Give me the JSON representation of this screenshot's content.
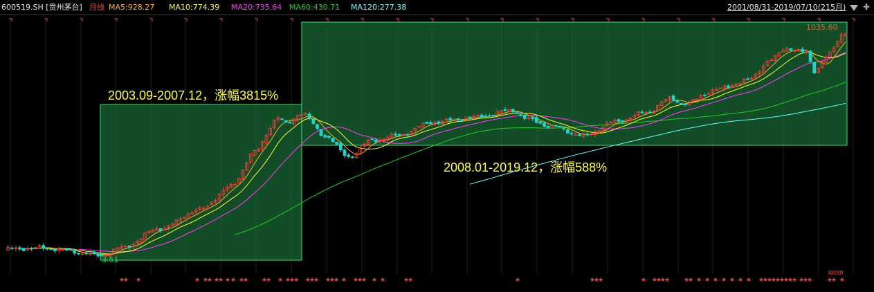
{
  "header": {
    "symbol": "600519.SH [贵州茅台]",
    "period": "月线",
    "ma5": "MA5:928.27",
    "ma10": "MA10:774.39",
    "ma20": "MA20:735.64",
    "ma60": "MA60:430.71",
    "ma120": "MA120:277.38",
    "date_range": "2001/08/31-2019/07/10(215月)",
    "dropdown_icon": "triangle-down-icon",
    "expand_icon": "plus-icon"
  },
  "colors": {
    "background": "#000000",
    "up": "#ff3b3b",
    "down": "#22d3c9",
    "ma5": "#ffb21e",
    "ma10": "#ffff33",
    "ma20": "#ff3bff",
    "ma60": "#22cc22",
    "ma120": "#66ffff",
    "highlight_fill": "#1a6b38",
    "highlight_border": "#40e080",
    "annotation": "#ffff44",
    "star": "#ff3b3b"
  },
  "chart_data": {
    "type": "candlestick",
    "period": "monthly",
    "x_range": [
      "2001-08",
      "2019-07"
    ],
    "bar_count": 215,
    "y_range": [
      3.51,
      1035.6
    ],
    "highest_label": "1035.60",
    "lowest_label": "3.51",
    "moving_averages": [
      {
        "name": "MA5",
        "value": 928.27
      },
      {
        "name": "MA10",
        "value": 774.39
      },
      {
        "name": "MA20",
        "value": 735.64
      },
      {
        "name": "MA60",
        "value": 430.71
      },
      {
        "name": "MA120",
        "value": 277.38
      }
    ],
    "highlights": [
      {
        "from": "2003-09",
        "to": "2007-12",
        "gain": "3815%",
        "label": "2003.09-2007.12，涨幅3815%"
      },
      {
        "from": "2008-01",
        "to": "2019-12",
        "gain": "588%",
        "label": "2008.01-2019.12，涨幅588%"
      }
    ],
    "close_path": [
      {
        "month": 0,
        "close": 0.03
      },
      {
        "month": 10,
        "close": 0.035
      },
      {
        "month": 20,
        "close": 0.015
      },
      {
        "month": 24,
        "close": 0.0
      },
      {
        "month": 30,
        "close": 0.035
      },
      {
        "month": 40,
        "close": 0.12
      },
      {
        "month": 50,
        "close": 0.2
      },
      {
        "month": 58,
        "close": 0.3
      },
      {
        "month": 64,
        "close": 0.45
      },
      {
        "month": 70,
        "close": 0.6
      },
      {
        "month": 72,
        "close": 0.57
      },
      {
        "month": 76,
        "close": 0.62
      },
      {
        "month": 82,
        "close": 0.52
      },
      {
        "month": 88,
        "close": 0.43
      },
      {
        "month": 94,
        "close": 0.5
      },
      {
        "month": 100,
        "close": 0.52
      },
      {
        "month": 110,
        "close": 0.58
      },
      {
        "month": 120,
        "close": 0.6
      },
      {
        "month": 130,
        "close": 0.63
      },
      {
        "month": 134,
        "close": 0.59
      },
      {
        "month": 140,
        "close": 0.56
      },
      {
        "month": 148,
        "close": 0.52
      },
      {
        "month": 156,
        "close": 0.58
      },
      {
        "month": 164,
        "close": 0.62
      },
      {
        "month": 170,
        "close": 0.68
      },
      {
        "month": 174,
        "close": 0.66
      },
      {
        "month": 182,
        "close": 0.72
      },
      {
        "month": 190,
        "close": 0.76
      },
      {
        "month": 196,
        "close": 0.85
      },
      {
        "month": 200,
        "close": 0.9
      },
      {
        "month": 205,
        "close": 0.88
      },
      {
        "month": 207,
        "close": 0.8
      },
      {
        "month": 210,
        "close": 0.86
      },
      {
        "month": 215,
        "close": 0.97
      }
    ],
    "star_markers": "★",
    "bottom_label": "RRRR"
  }
}
